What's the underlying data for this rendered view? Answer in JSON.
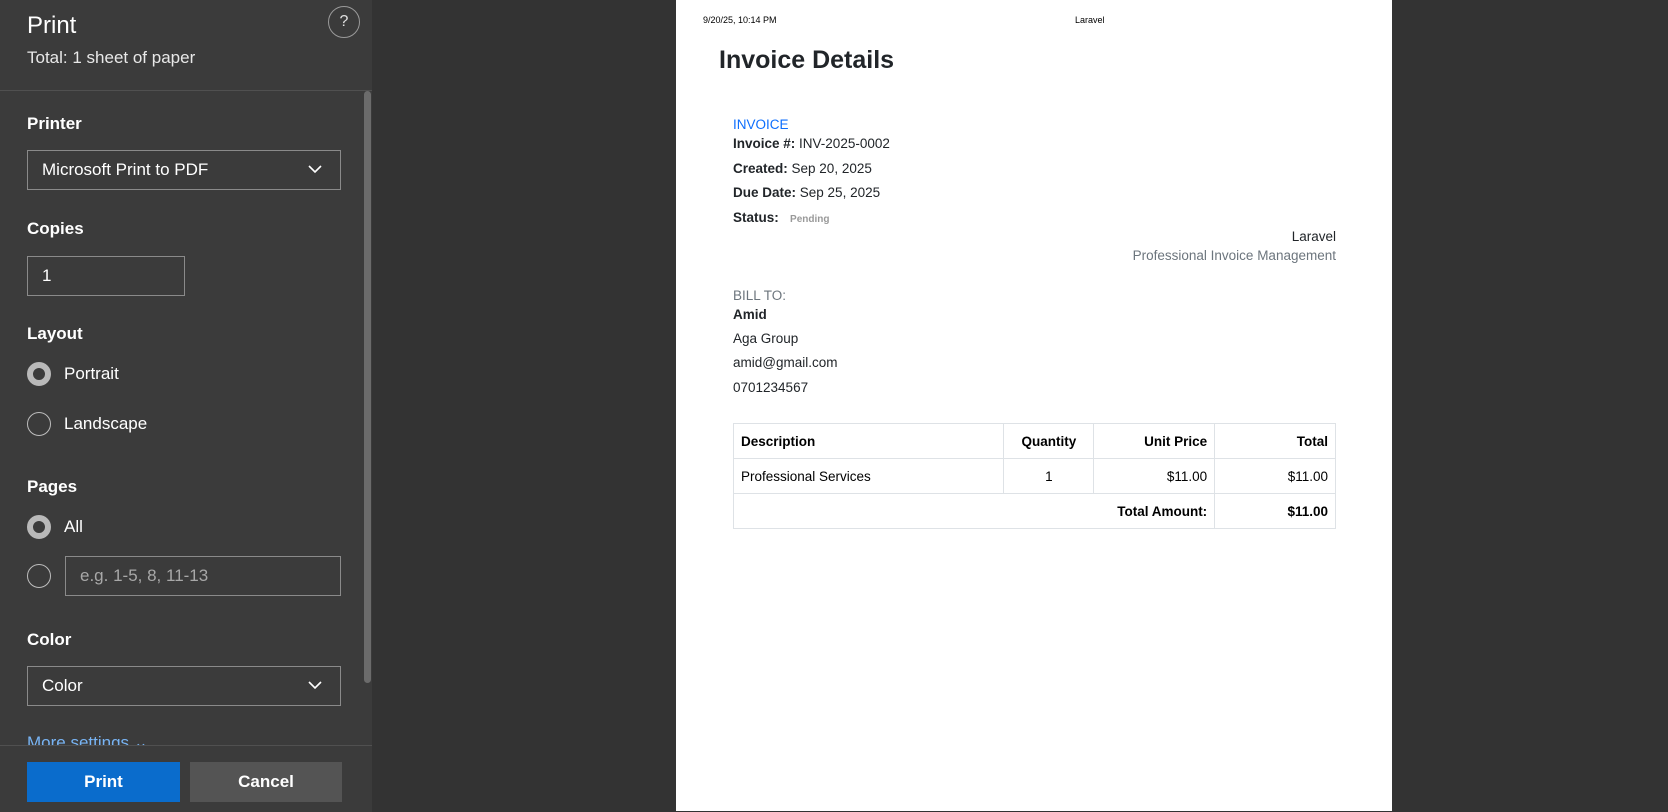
{
  "panel": {
    "title": "Print",
    "subtitle": "Total: 1 sheet of paper",
    "help": "?",
    "printer": {
      "label": "Printer",
      "value": "Microsoft Print to PDF"
    },
    "copies": {
      "label": "Copies",
      "value": "1"
    },
    "layout": {
      "label": "Layout",
      "options": [
        "Portrait",
        "Landscape"
      ],
      "selected": "Portrait"
    },
    "pages": {
      "label": "Pages",
      "all_label": "All",
      "custom_placeholder": "e.g. 1-5, 8, 11-13"
    },
    "color": {
      "label": "Color",
      "value": "Color"
    },
    "more_settings": "More settings",
    "print_button": "Print",
    "cancel_button": "Cancel",
    "accent": "#0a6ccc"
  },
  "preview": {
    "header_left": "9/20/25, 10:14 PM",
    "header_center": "Laravel",
    "heading": "Invoice Details",
    "invoice_label": "INVOICE",
    "invoice_number_label": "Invoice #:",
    "invoice_number": "INV-2025-0002",
    "created_label": "Created:",
    "created": "Sep 20, 2025",
    "due_label": "Due Date:",
    "due": "Sep 25, 2025",
    "status_label": "Status:",
    "status": "Pending",
    "company_name": "Laravel",
    "company_tagline": "Professional Invoice Management",
    "bill_to_label": "BILL TO:",
    "client_name": "Amid",
    "client_company": "Aga Group",
    "client_email": "amid@gmail.com",
    "client_phone": "0701234567",
    "table": {
      "headers": [
        "Description",
        "Quantity",
        "Unit Price",
        "Total"
      ],
      "rows": [
        [
          "Professional Services",
          "1",
          "$11.00",
          "$11.00"
        ]
      ],
      "total_label": "Total Amount:",
      "total_value": "$11.00"
    }
  }
}
